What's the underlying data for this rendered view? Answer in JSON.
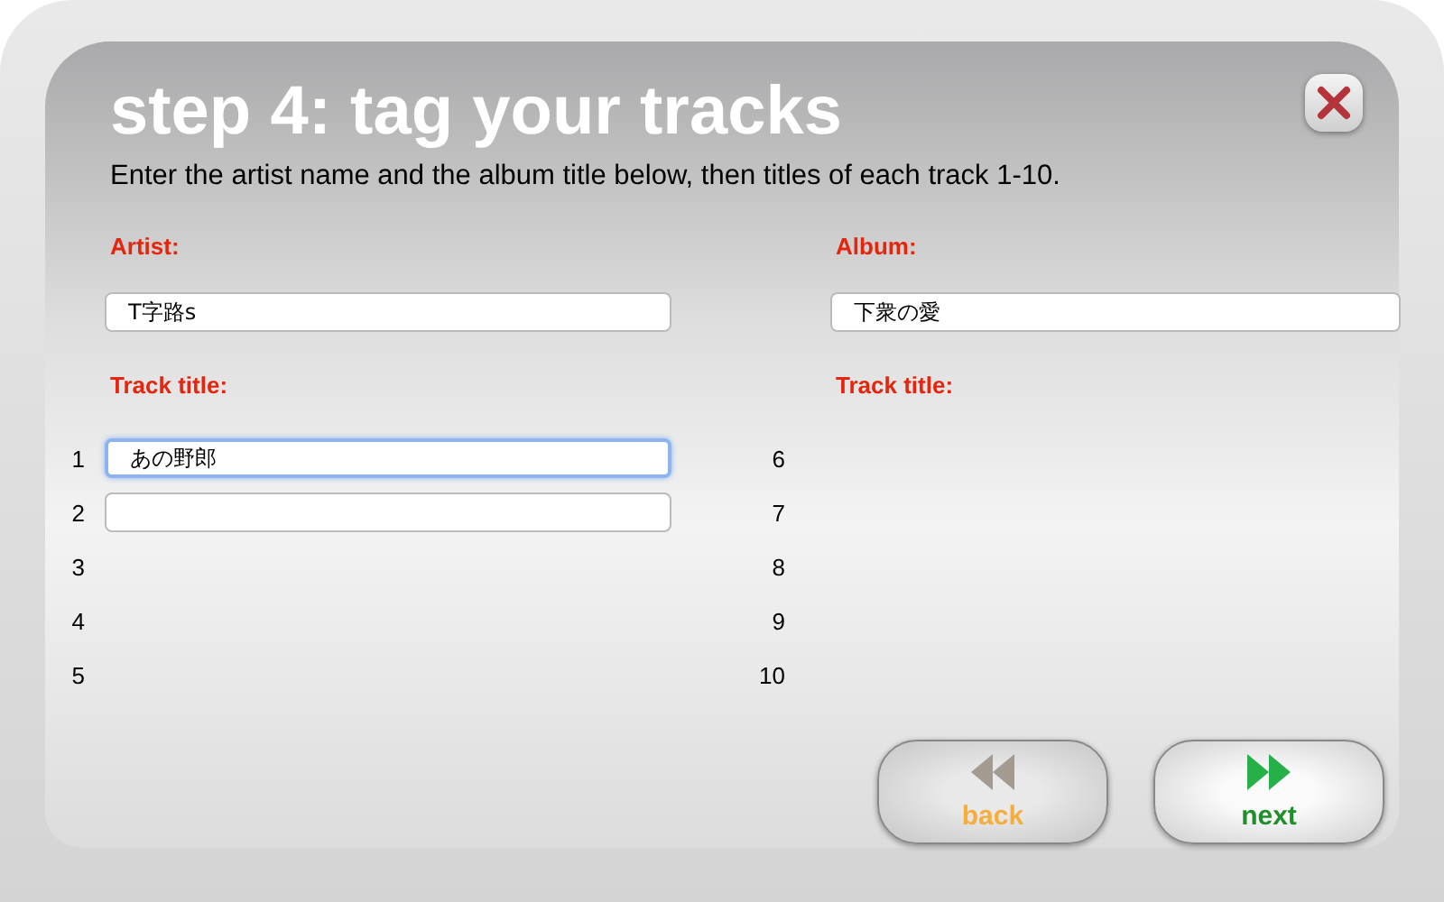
{
  "dialog": {
    "title": "step 4: tag your tracks",
    "instructions": "Enter the artist name and the album title below, then titles of each track 1-10."
  },
  "artist": {
    "label": "Artist:",
    "value": "T字路s"
  },
  "album": {
    "label": "Album:",
    "value": "下衆の愛"
  },
  "track_columns": [
    {
      "label": "Track title:",
      "tracks": [
        {
          "number": "1",
          "kind": "field",
          "value": "あの野郎",
          "focused": true
        },
        {
          "number": "2",
          "kind": "field",
          "focused": false
        },
        {
          "number": "3",
          "kind": "blank"
        },
        {
          "number": "4",
          "kind": "blank"
        },
        {
          "number": "5",
          "kind": "blank"
        }
      ]
    },
    {
      "label": "Track title:",
      "tracks": [
        {
          "number": "6",
          "kind": "blank"
        },
        {
          "number": "7",
          "kind": "blank"
        },
        {
          "number": "8",
          "kind": "blank"
        },
        {
          "number": "9",
          "kind": "blank"
        },
        {
          "number": "10",
          "kind": "blank"
        }
      ]
    }
  ],
  "buttons": [
    {
      "kind": "back",
      "label": "back"
    },
    {
      "kind": "next",
      "label": "next"
    }
  ]
}
